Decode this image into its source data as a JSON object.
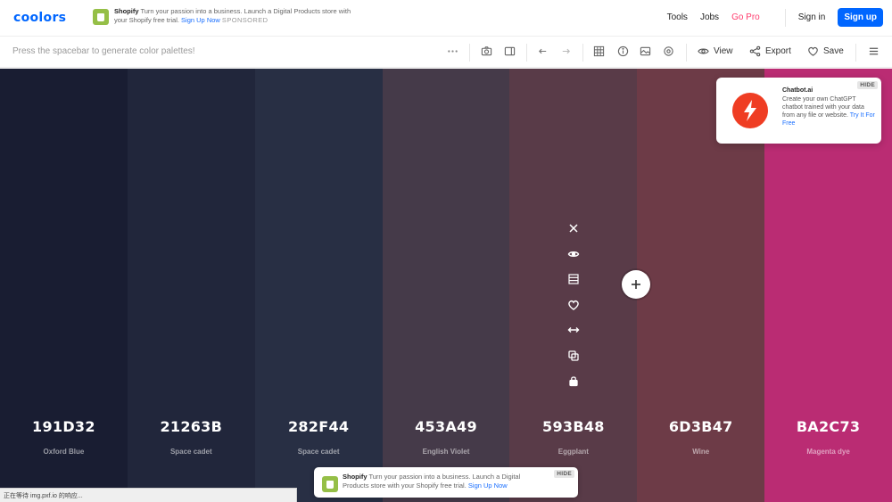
{
  "topbar": {
    "logo": "coolors",
    "ad": {
      "brand": "Shopify",
      "text": "Turn your passion into a business. Launch a Digital Products store with your Shopify free trial.",
      "link": "Sign Up Now",
      "sponsored": "SPONSORED"
    },
    "nav": {
      "tools": "Tools",
      "jobs": "Jobs",
      "gopro": "Go Pro",
      "signin": "Sign in",
      "signup": "Sign up"
    }
  },
  "toolbar": {
    "hint": "Press the spacebar to generate color palettes!",
    "view_label": "View",
    "export_label": "Export",
    "save_label": "Save"
  },
  "palette": [
    {
      "hex": "191D32",
      "name": "Oxford Blue",
      "color": "#191D32"
    },
    {
      "hex": "21263B",
      "name": "Space cadet",
      "color": "#21263B"
    },
    {
      "hex": "282F44",
      "name": "Space cadet",
      "color": "#282F44"
    },
    {
      "hex": "453A49",
      "name": "English Violet",
      "color": "#453A49"
    },
    {
      "hex": "593B48",
      "name": "Eggplant",
      "color": "#593B48"
    },
    {
      "hex": "6D3B47",
      "name": "Wine",
      "color": "#6D3B47"
    },
    {
      "hex": "BA2C73",
      "name": "Magenta dye",
      "color": "#BA2C73"
    }
  ],
  "ad_card": {
    "brand": "Chatbot.ai",
    "text": "Create your own ChatGPT chatbot trained with your data from any file or website.",
    "link": "Try It For Free",
    "hide": "HIDE"
  },
  "ad_bottom": {
    "brand": "Shopify",
    "text": "Turn your passion into a business. Launch a Digital Products store with your Shopify free trial.",
    "link": "Sign Up Now",
    "hide": "HIDE"
  },
  "status_bar": {
    "text": "正在等待 img.pxf.io 的响应..."
  }
}
